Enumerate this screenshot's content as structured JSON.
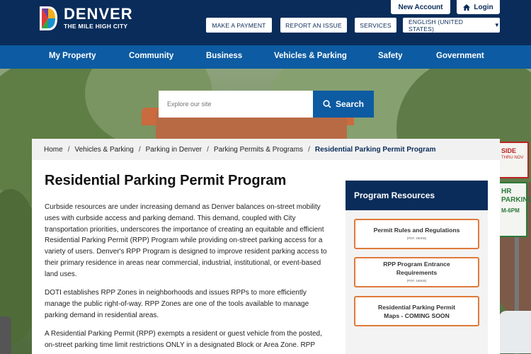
{
  "header": {
    "logo": {
      "title": "DENVER",
      "tagline": "THE MILE HIGH CITY"
    },
    "account": {
      "new_account": "New Account",
      "login": "Login"
    },
    "utility": {
      "make_payment": "MAKE A PAYMENT",
      "report_issue": "REPORT AN ISSUE",
      "services": "SERVICES",
      "language": "ENGLISH (UNITED STATES)"
    }
  },
  "nav": {
    "items": [
      "My Property",
      "Community",
      "Business",
      "Vehicles & Parking",
      "Safety",
      "Government"
    ]
  },
  "search": {
    "placeholder": "Explore our site",
    "button": "Search"
  },
  "breadcrumb": [
    "Home",
    "Vehicles & Parking",
    "Parking in Denver",
    "Parking Permits & Programs",
    "Residential Parking Permit Program"
  ],
  "main": {
    "title": "Residential Parking Permit Program",
    "paragraphs": [
      "Curbside resources are under increasing demand as Denver balances on-street mobility uses with curbside access and parking demand. This demand, coupled with City transportation priorities, underscores the importance of creating an equitable and efficient Residential Parking Permit (RPP) Program while providing on-street parking access for a variety of users. Denver's RPP Program is designed to improve resident parking access to their primary residence in areas near commercial, industrial, institutional, or event-based land uses.",
      "DOTI establishes RPP Zones in neighborhoods and issues RPPs to more efficiently manage the public right-of-way. RPP Zones are one of the tools available to manage parking demand in residential areas.",
      "A Residential Parking Permit (RPP) exempts a resident or guest vehicle from the posted, on-street parking time limit restrictions ONLY in a designated Block or Area Zone. RPP"
    ]
  },
  "sidebar": {
    "title": "Program Resources",
    "resources": [
      {
        "label": "Permit Rules and Regulations",
        "meta": "(PDF, 460KB)"
      },
      {
        "label": "RPP Program Entrance Requirements",
        "meta": "(PDF, 166KB)"
      },
      {
        "label": "Residential Parking Permit Maps - COMING SOON",
        "meta": ""
      }
    ]
  },
  "colors": {
    "navy": "#0a2c5a",
    "nav_blue": "#0d5ba2",
    "accent_orange": "#e07a3a"
  },
  "background_signs": {
    "sign1": "SIDE",
    "sign1_sub": "THRU NOV",
    "sign2": "HR PARKING",
    "sign2_sub": "M-6PM"
  }
}
